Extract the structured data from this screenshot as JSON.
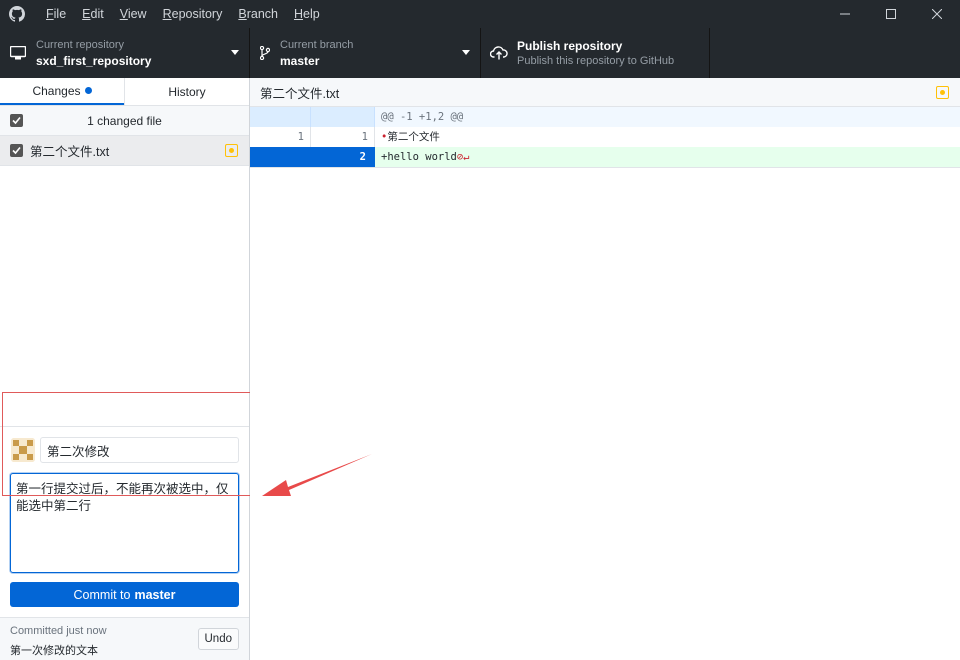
{
  "menu": {
    "items": [
      {
        "label": "File",
        "accel": "F",
        "rest": "ile"
      },
      {
        "label": "Edit",
        "accel": "E",
        "rest": "dit"
      },
      {
        "label": "View",
        "accel": "V",
        "rest": "iew"
      },
      {
        "label": "Repository",
        "accel": "R",
        "rest": "epository"
      },
      {
        "label": "Branch",
        "accel": "B",
        "rest": "ranch"
      },
      {
        "label": "Help",
        "accel": "H",
        "rest": "elp"
      }
    ]
  },
  "toolbar": {
    "repo_label": "Current repository",
    "repo_value": "sxd_first_repository",
    "branch_label": "Current branch",
    "branch_value": "master",
    "publish_title": "Publish repository",
    "publish_desc": "Publish this repository to GitHub"
  },
  "sidebar": {
    "tab_changes": "Changes",
    "tab_history": "History",
    "changes_count": "1 changed file",
    "files": [
      {
        "name": "第二个文件.txt",
        "status": "modified"
      }
    ]
  },
  "commit": {
    "summary": "第二次修改",
    "description": "第一行提交过后，不能再次被选中，仅能选中第二行",
    "button_prefix": "Commit to",
    "button_branch": "master",
    "last_label": "Committed just now",
    "last_message": "第一次修改的文本",
    "undo_label": "Undo"
  },
  "diff": {
    "filename": "第二个文件.txt",
    "hunk_header": "@@ -1 +1,2 @@",
    "lines": [
      {
        "old": "1",
        "new": "1",
        "text": "第二个文件",
        "type": "context"
      },
      {
        "old": "",
        "new": "2",
        "text": "+hello world",
        "type": "added"
      }
    ]
  },
  "colors": {
    "accent": "#0366d6",
    "titlebar": "#24292e",
    "modified": "#ffc107",
    "annotation": "#e84a4a"
  }
}
